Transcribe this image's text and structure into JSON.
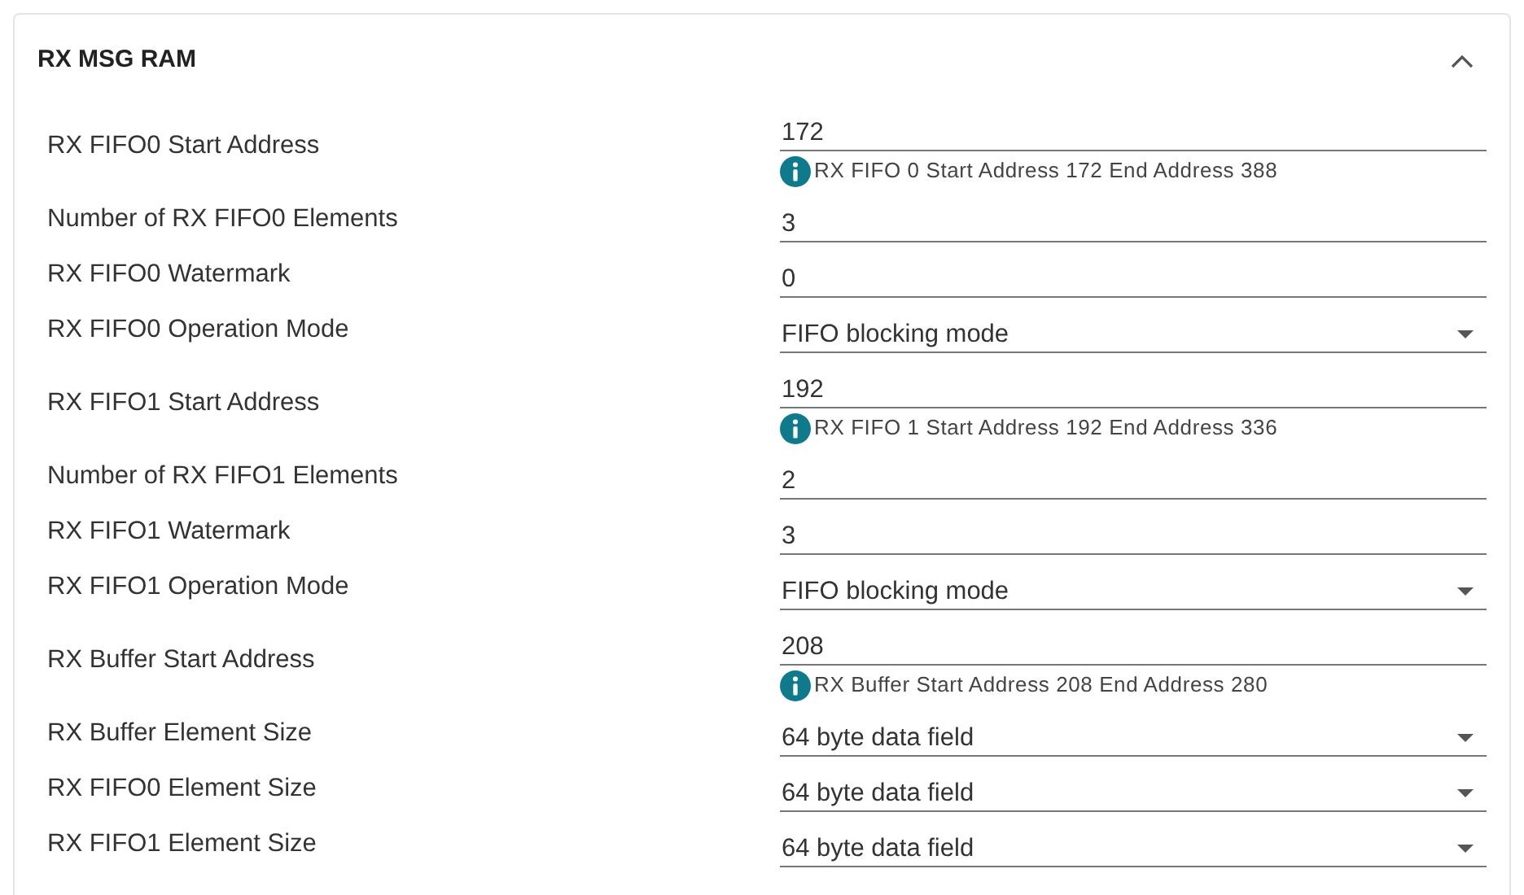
{
  "panel": {
    "title": "RX MSG RAM",
    "expanded": true
  },
  "fields": [
    {
      "label": "RX FIFO0 Start Address",
      "kind": "text",
      "value": "172",
      "info": "RX FIFO 0 Start Address 172 End Address 388"
    },
    {
      "label": "Number of RX FIFO0 Elements",
      "kind": "text",
      "value": "3"
    },
    {
      "label": "RX FIFO0 Watermark",
      "kind": "text",
      "value": "0"
    },
    {
      "label": "RX FIFO0 Operation Mode",
      "kind": "select",
      "value": "FIFO blocking mode"
    },
    {
      "label": "RX FIFO1 Start Address",
      "kind": "text",
      "value": "192",
      "info": "RX FIFO 1 Start Address 192 End Address 336"
    },
    {
      "label": "Number of RX FIFO1 Elements",
      "kind": "text",
      "value": "2"
    },
    {
      "label": "RX FIFO1 Watermark",
      "kind": "text",
      "value": "3"
    },
    {
      "label": "RX FIFO1 Operation Mode",
      "kind": "select",
      "value": "FIFO blocking mode"
    },
    {
      "label": "RX Buffer Start Address",
      "kind": "text",
      "value": "208",
      "info": "RX Buffer Start Address 208 End Address 280"
    },
    {
      "label": "RX Buffer Element Size",
      "kind": "select",
      "value": "64 byte data field"
    },
    {
      "label": "RX FIFO0 Element Size",
      "kind": "select",
      "value": "64 byte data field"
    },
    {
      "label": "RX FIFO1 Element Size",
      "kind": "select",
      "value": "64 byte data field"
    }
  ]
}
